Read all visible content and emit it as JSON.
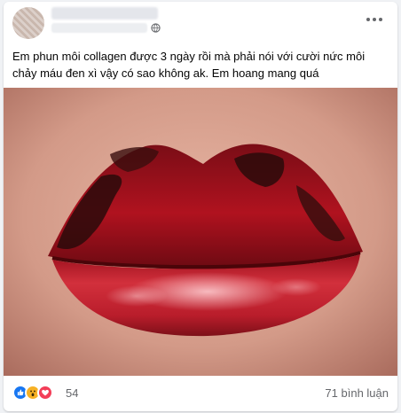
{
  "post": {
    "author_avatar": "avatar-blurred",
    "privacy_icon": "globe-icon",
    "more_icon": "more-options-icon",
    "text": "Em phun môi collagen được 3 ngày rồi mà phải nói với cười nức môi chảy máu đen xì vậy có sao không ak. Em hoang mang quá"
  },
  "reactions": {
    "icons": [
      "like-icon",
      "wow-icon",
      "love-icon"
    ],
    "count": "54",
    "comments": "71 bình luận"
  },
  "colors": {
    "like": "#1877f2",
    "wow": "#f7b125",
    "love": "#f33e58",
    "secondary_text": "#65676b"
  }
}
